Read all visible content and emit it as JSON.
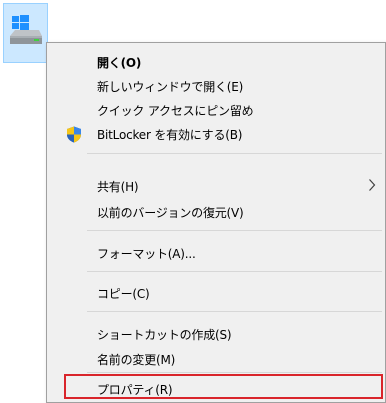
{
  "menu": {
    "items": [
      {
        "label": "開く(O)"
      },
      {
        "label": "新しいウィンドウで開く(E)"
      },
      {
        "label": "クイック アクセスにピン留め"
      },
      {
        "label": "BitLocker を有効にする(B)",
        "icon": "uac-shield-icon"
      },
      {
        "label": "共有(H)",
        "submenu": true
      },
      {
        "label": "以前のバージョンの復元(V)"
      },
      {
        "label": "フォーマット(A)..."
      },
      {
        "label": "コピー(C)"
      },
      {
        "label": "ショートカットの作成(S)"
      },
      {
        "label": "名前の変更(M)"
      },
      {
        "label": "プロパティ(R)"
      }
    ]
  },
  "colors": {
    "menu_background": "#f0f0f0",
    "highlight_border": "#d9252b",
    "selection_background": "#cce8ff"
  }
}
